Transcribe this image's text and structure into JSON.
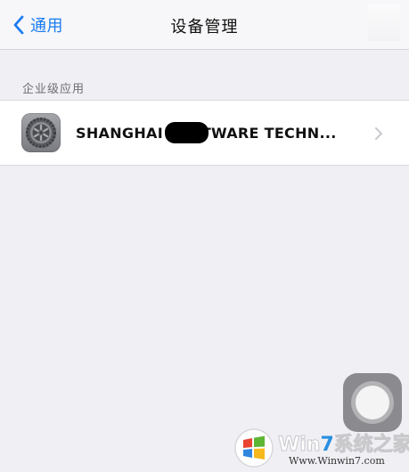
{
  "nav": {
    "back_label": "通用",
    "title": "设备管理"
  },
  "section": {
    "header": "企业级应用",
    "items": [
      {
        "name": "SHANGHAI       SOFTWARE TECHN...",
        "icon": "settings-gear-icon"
      }
    ]
  },
  "watermark": {
    "brand_prefix": "Win",
    "brand_digit": "7",
    "brand_suffix": "系统之家",
    "url": "Www.Winwin7.com",
    "icon": "windows-logo-icon"
  },
  "colors": {
    "accent": "#1a7cf0",
    "background": "#efeff4",
    "nav_background": "#f7f7f9",
    "row_background": "#ffffff",
    "section_text": "#6d6d72"
  }
}
